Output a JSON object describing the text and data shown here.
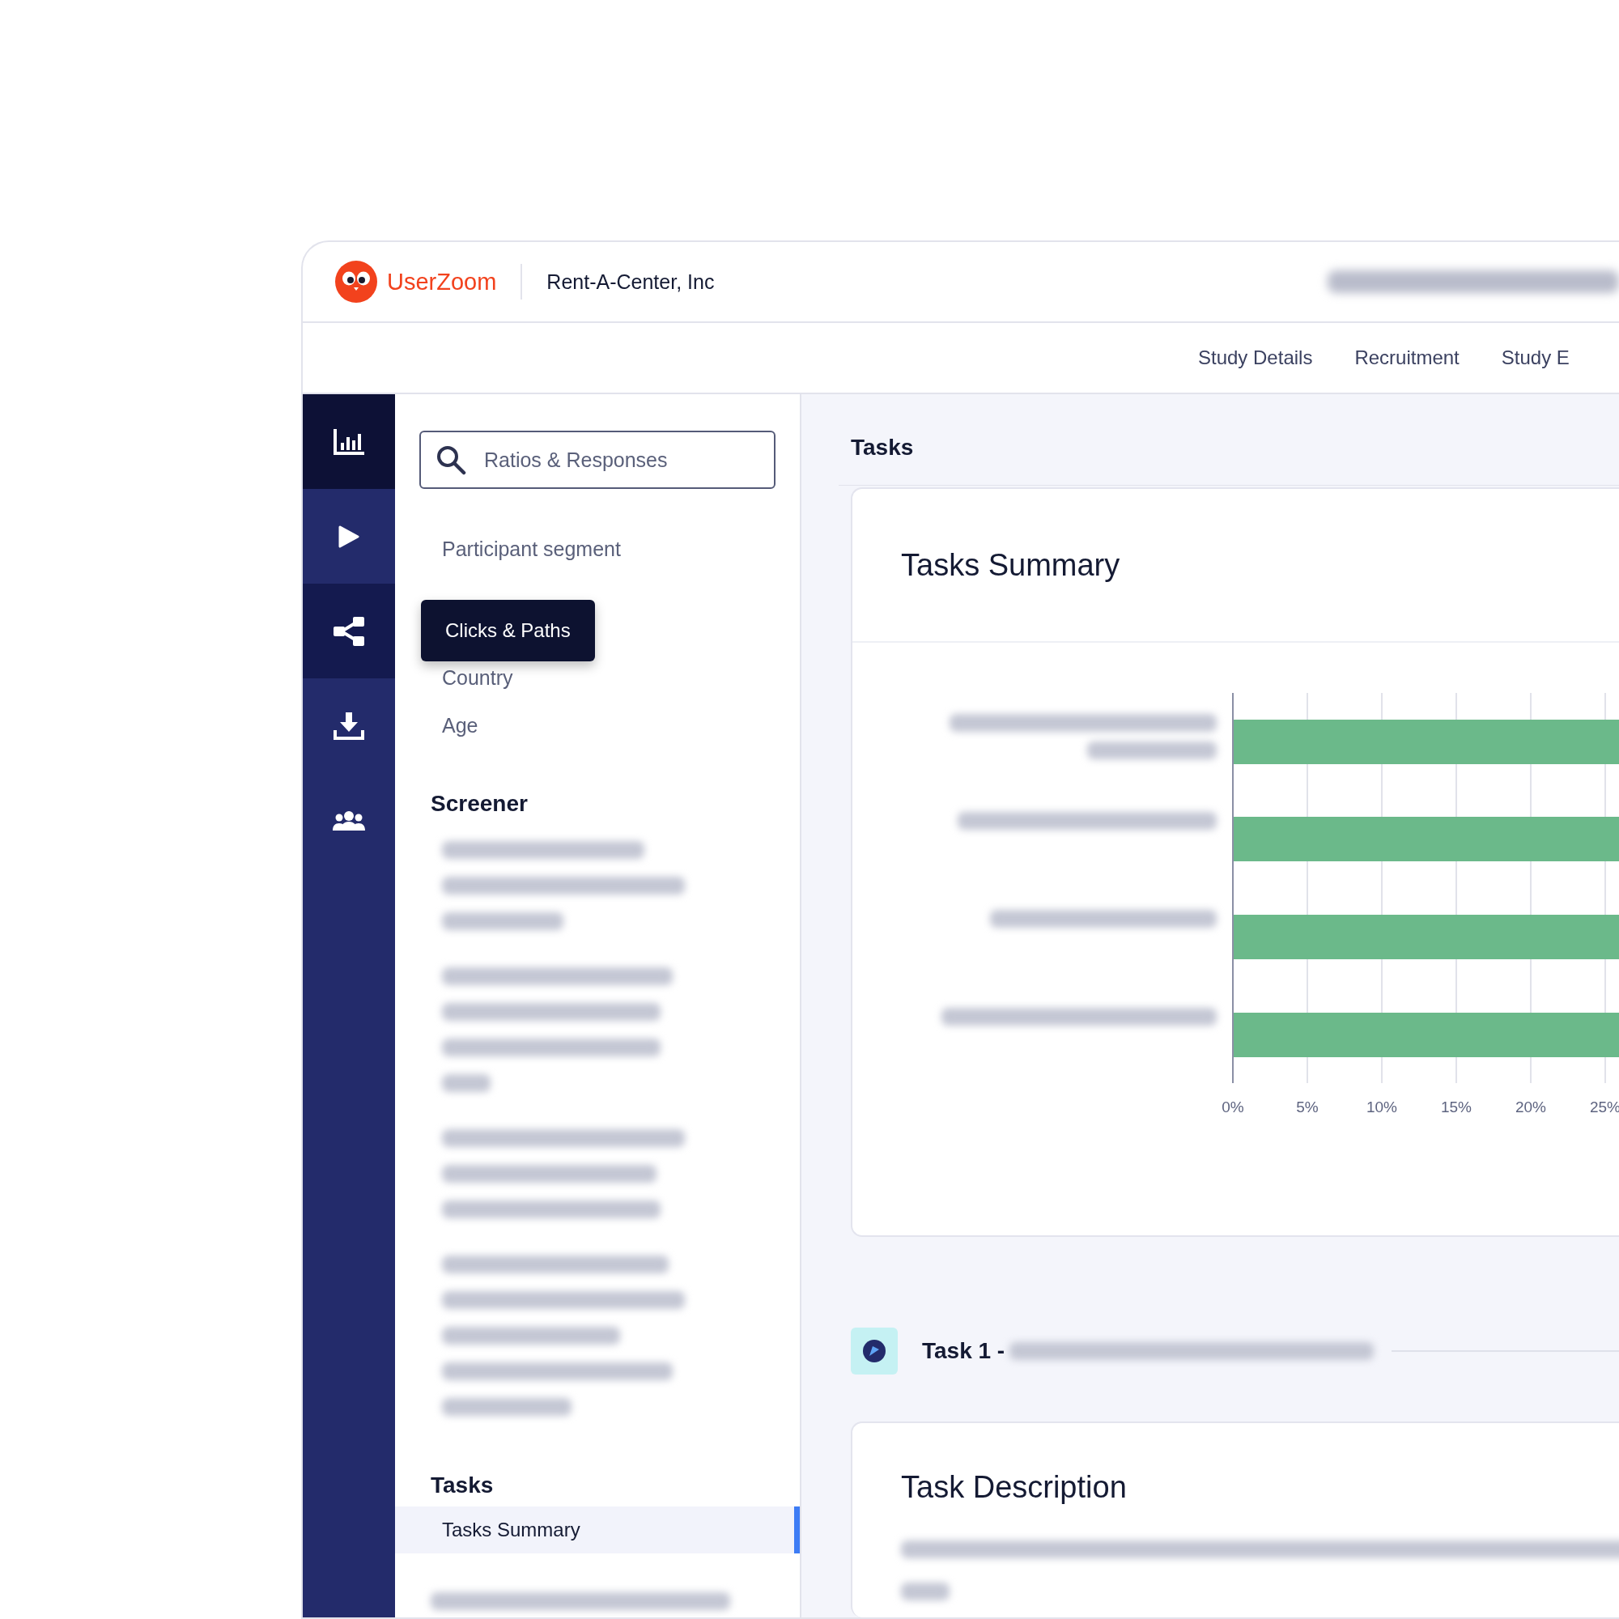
{
  "header": {
    "brand": "UserZoom",
    "company": "Rent-A-Center, Inc"
  },
  "nav": {
    "links": [
      "Study Details",
      "Recruitment",
      "Study E"
    ]
  },
  "rail": [
    {
      "kind": "chart",
      "selected": true,
      "hovered": false
    },
    {
      "kind": "play",
      "selected": false,
      "hovered": false
    },
    {
      "kind": "paths",
      "selected": false,
      "hovered": true,
      "tooltip": "Clicks & Paths"
    },
    {
      "kind": "download",
      "selected": false,
      "hovered": false
    },
    {
      "kind": "people",
      "selected": false,
      "hovered": false
    }
  ],
  "sidebar": {
    "search": {
      "placeholder": "Ratios & Responses"
    },
    "segments": [
      "Participant segment",
      "Country",
      "Age"
    ],
    "screener": {
      "heading": "Screener"
    },
    "tasks": {
      "heading": "Tasks",
      "items": [
        {
          "label": "Tasks Summary",
          "selected": true
        }
      ]
    }
  },
  "main": {
    "title": "Tasks",
    "summary": {
      "title": "Tasks Summary",
      "tick_labels": [
        "0%",
        "5%",
        "10%",
        "15%",
        "20%",
        "25%"
      ]
    },
    "task": {
      "prefix": "Task 1 -"
    },
    "description": {
      "title": "Task Description"
    }
  }
}
